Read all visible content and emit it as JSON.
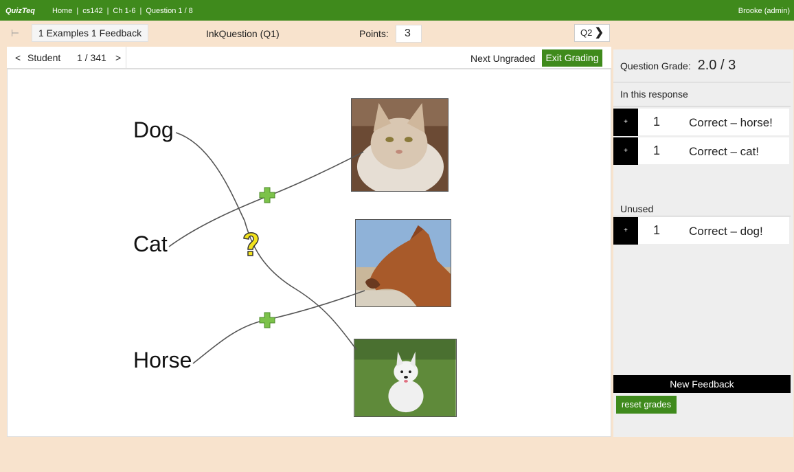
{
  "topbar": {
    "logo": "QuizTeq",
    "breadcrumbs": [
      "Home",
      "cs142",
      "Ch 1-6",
      "Question 1 / 8"
    ],
    "user": "Brooke  (admin)"
  },
  "subbar": {
    "pin_glyph": "⊢",
    "feedback_label": "1 Examples 1 Feedback",
    "question_title": "InkQuestion (Q1)",
    "points_label": "Points:",
    "points_value": "3",
    "next_question_label": "Q2"
  },
  "studentbar": {
    "prev": "<",
    "label": "Student",
    "count": "1 / 341",
    "next": ">",
    "next_ungraded": "Next Ungraded",
    "exit_grading": "Exit Grading"
  },
  "canvas": {
    "words": [
      "Dog",
      "Cat",
      "Horse"
    ]
  },
  "panel": {
    "grade_label": "Question Grade:",
    "grade_value": "2.0 / 3",
    "in_response_label": "In this response",
    "applied": [
      {
        "plus": "+",
        "points": "1",
        "text": "Correct – horse!"
      },
      {
        "plus": "+",
        "points": "1",
        "text": "Correct – cat!"
      }
    ],
    "unused_label": "Unused",
    "unused": [
      {
        "plus": "+",
        "points": "1",
        "text": "Correct – dog!"
      }
    ],
    "new_feedback": "New Feedback",
    "reset_grades": "reset grades"
  },
  "colors": {
    "brand_green": "#3f8a1c",
    "background": "#f8e3cd",
    "mark_correct": "#7cc24a",
    "mark_question": "#f2e21d"
  }
}
